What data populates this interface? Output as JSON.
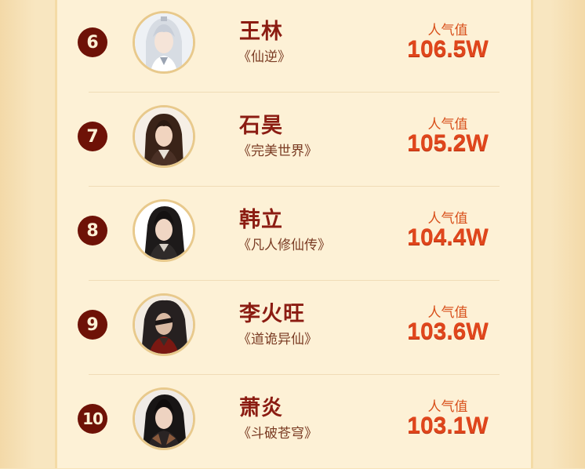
{
  "colors": {
    "rank_circle": "#6e1207",
    "name": "#8b1c12",
    "work": "#7a3b23",
    "popularity": "#e0461c",
    "panel": "#fdf1d6",
    "background": "#f7e3b9"
  },
  "ranking": [
    {
      "rank": "6",
      "name": "王林",
      "work": "《仙逆》",
      "pop_label": "人气值",
      "pop_value": "106.5W",
      "avatar": "avatar-wang-lin"
    },
    {
      "rank": "7",
      "name": "石昊",
      "work": "《完美世界》",
      "pop_label": "人气值",
      "pop_value": "105.2W",
      "avatar": "avatar-shi-hao"
    },
    {
      "rank": "8",
      "name": "韩立",
      "work": "《凡人修仙传》",
      "pop_label": "人气值",
      "pop_value": "104.4W",
      "avatar": "avatar-han-li"
    },
    {
      "rank": "9",
      "name": "李火旺",
      "work": "《道诡异仙》",
      "pop_label": "人气值",
      "pop_value": "103.6W",
      "avatar": "avatar-li-huowang"
    },
    {
      "rank": "10",
      "name": "萧炎",
      "work": "《斗破苍穹》",
      "pop_label": "人气值",
      "pop_value": "103.1W",
      "avatar": "avatar-xiao-yan"
    }
  ]
}
